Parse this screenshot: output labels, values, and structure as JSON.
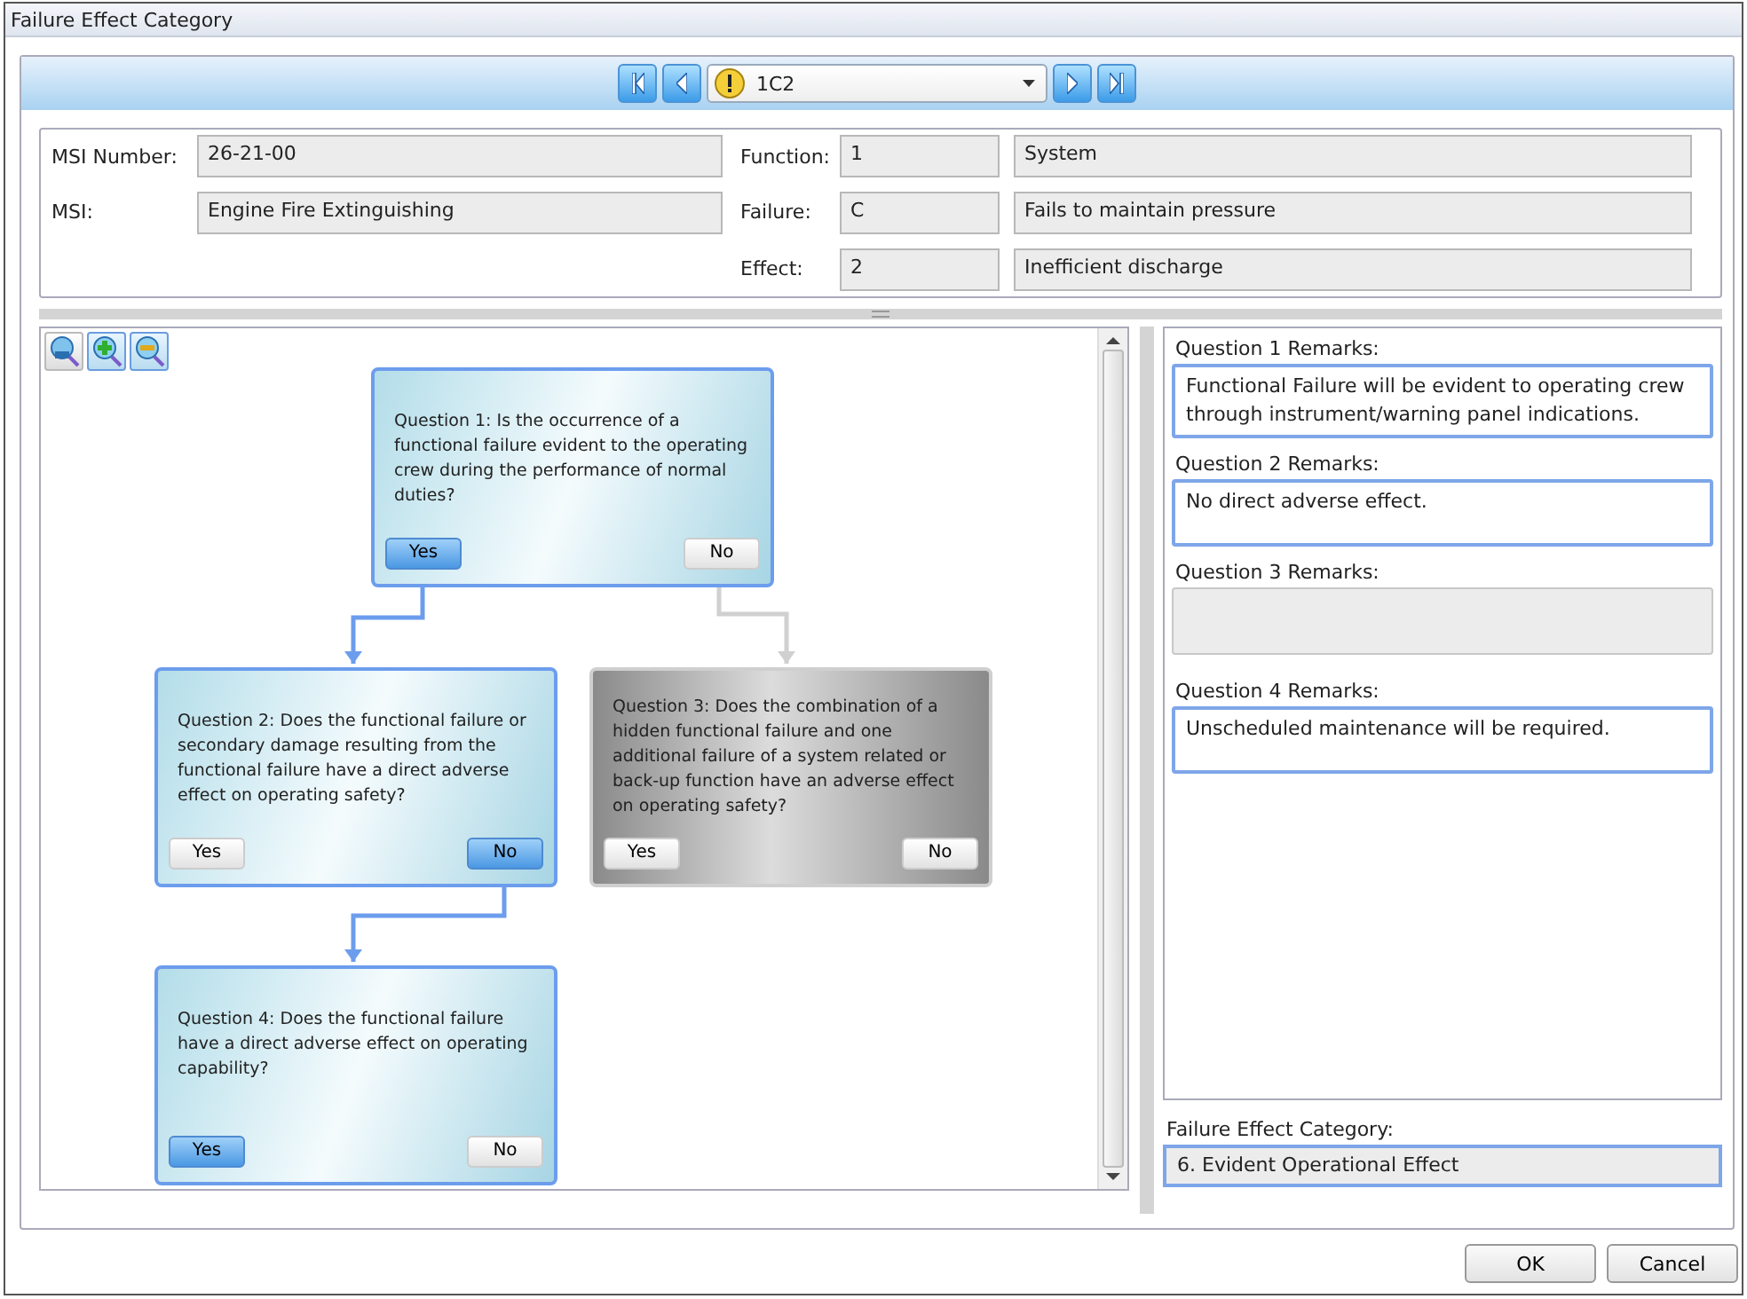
{
  "window": {
    "title": "Failure Effect Category"
  },
  "navigator": {
    "value": "1C2"
  },
  "info": {
    "msi_number_label": "MSI Number:",
    "msi_number": "26-21-00",
    "msi_label": "MSI:",
    "msi": "Engine Fire Extinguishing",
    "rows": [
      {
        "label": "Function:",
        "code": "1",
        "text": "System"
      },
      {
        "label": "Failure:",
        "code": "C",
        "text": "Fails to maintain pressure"
      },
      {
        "label": "Effect:",
        "code": "2",
        "text": "Inefficient discharge"
      }
    ]
  },
  "diagram": {
    "questions": [
      {
        "text": "Question 1: Is the occurrence of a functional failure evident to the operating crew during the performance of normal duties?",
        "active": true,
        "yes": {
          "label": "Yes",
          "selected": true
        },
        "no": {
          "label": "No",
          "selected": false
        }
      },
      {
        "text": "Question 2: Does the functional failure or secondary damage resulting from the functional failure have a direct adverse effect on operating safety?",
        "active": true,
        "yes": {
          "label": "Yes",
          "selected": false
        },
        "no": {
          "label": "No",
          "selected": true
        }
      },
      {
        "text": "Question 3: Does the combination of a hidden functional failure and one additional failure of a system related or back-up function have an adverse effect on operating safety?",
        "active": false,
        "yes": {
          "label": "Yes",
          "selected": false
        },
        "no": {
          "label": "No",
          "selected": false
        }
      },
      {
        "text": "Question 4: Does the functional failure have a direct adverse effect on operating capability?",
        "active": true,
        "yes": {
          "label": "Yes",
          "selected": true
        },
        "no": {
          "label": "No",
          "selected": false
        }
      }
    ]
  },
  "remarks": [
    {
      "label": "Question 1 Remarks:",
      "value": "Functional Failure will be evident to operating crew through instrument/warning panel indications.",
      "disabled": false
    },
    {
      "label": "Question 2 Remarks:",
      "value": "No direct adverse effect.",
      "disabled": false
    },
    {
      "label": "Question 3 Remarks:",
      "disabled": true
    },
    {
      "label": "Question 4 Remarks:",
      "value": "Unscheduled maintenance will be required.",
      "disabled": false
    }
  ],
  "category": {
    "label": "Failure Effect Category:",
    "value": "6. Evident Operational Effect"
  },
  "buttons": [
    "OK",
    "Cancel"
  ]
}
